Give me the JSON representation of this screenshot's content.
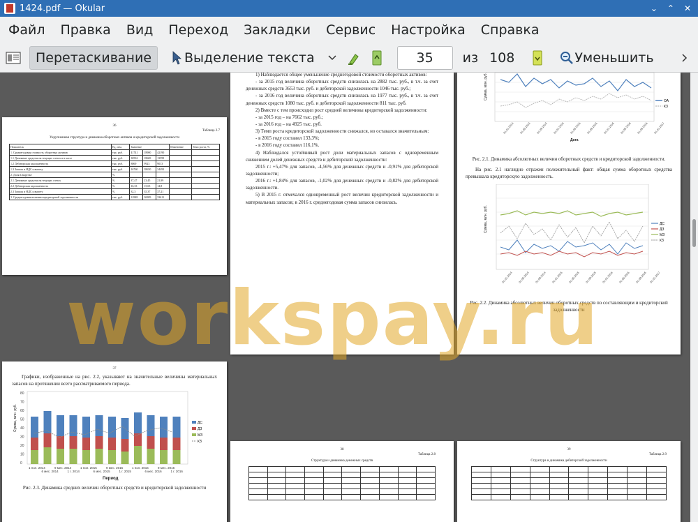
{
  "window": {
    "title": "1424.pdf  — Okular",
    "controls": [
      "⌄",
      "⌃",
      "✕"
    ]
  },
  "menu": [
    "Файл",
    "Правка",
    "Вид",
    "Переход",
    "Закладки",
    "Сервис",
    "Настройка",
    "Справка"
  ],
  "toolbar": {
    "drag_label": "Перетаскивание",
    "select_label": "Выделение текста",
    "page_value": "35",
    "of_label": "из",
    "total_pages": "108",
    "zoom_out_label": "Уменьшить"
  },
  "watermark": "workspay.ru",
  "left_page": {
    "page_no": "36",
    "table_label": "Таблица 2.7",
    "table_title": "Укрупненная структура и динамика оборотных активов и кредиторской задолженности",
    "col_header_0": "Показатель",
    "col_header_1": "Ед. изм.",
    "col_header_2": "Значение",
    "col_header_3": "Изменение",
    "col_header_4": "Темп роста, %",
    "rows": [
      [
        "1. Среднегодовая стоимость оборотных активов",
        "тыс. руб.",
        "41741",
        "18900",
        "42190"
      ],
      [
        "1.1 Денежные средства на текущих счетах и в кассе",
        "тыс. руб.",
        "30532",
        "18669",
        "13599"
      ],
      [
        "1.2 Дебиторская задолженность",
        "тыс. руб.",
        "8069",
        "9923",
        "9013"
      ],
      [
        "1.3 Запасы и НДС к вычету",
        "тыс. руб.",
        "16760",
        "38650",
        "34492"
      ],
      [
        "2. Доля в выручке",
        "%",
        "",
        "",
        ""
      ],
      [
        "2.1 Денежные средства на текущих счетах",
        "%",
        "37,47",
        "23,45",
        "21,99"
      ],
      [
        "2.2 Дебиторская задолженность",
        "%",
        "16,33",
        "15,65",
        "14,8"
      ],
      [
        "2.3 Запасы и НДС к вычету",
        "%",
        "32,3",
        "35,37",
        "37,21"
      ],
      [
        "3. Среднегодовая величина кредиторской задолженности",
        "тыс. руб.",
        "31848",
        "36909",
        "33611"
      ]
    ]
  },
  "center_page": {
    "p0": "1) Наблюдается общее уменьшение среднегодовой стоимости оборотных активов:",
    "p1": "- за 2015 год величина оборотных средств снизилась на 2882 тыс. руб., в т.ч. за счет денежных средств 3653 тыс. руб. и дебиторской задолженности 1046 тыс. руб.;",
    "p2": "- за 2016 год величина оборотных средств снизилась на 1977 тыс. руб., в т.ч. за счет денежных средств 1080 тыс. руб. и дебиторской задолженности 811 тыс. руб.",
    "p3": "2) Вместе с тем происходил рост средней величины кредиторской задолженности:",
    "p4": "- за 2015 год – на 7662 тыс. руб.;",
    "p5": "- за 2016 год – на 4925 тыс. руб.",
    "p6": "3) Темп роста кредиторской задолженности снижался, но оставался значительным:",
    "p7": "- в 2015 году составил 133,3%;",
    "p8": "- в 2016 году составил 116,1%.",
    "p9": "4) Наблюдался устойчивый рост доли материальных запасов с одновременным снижением долей денежных средств и дебиторской задолженности:",
    "p10": "2015 г.: +5,47% для запасов, -4,56% для денежных средств и -0,91% для дебиторской задолженности;",
    "p11": "2016 г.: +1,84% для запасов, -1,02% для денежных средств и -0,82% для дебиторской задолженности.",
    "p12": "5) В 2015 г. отмечался одновременный рост величин кредиторской задолженности и материальных запасов; в 2016 г. среднегодовая сумма запасов снизилась."
  },
  "right_page": {
    "fig1_caption": "Рис. 2.1. Динамика абсолютных величин оборотных средств и кредиторской задолженности.",
    "para": "На рис. 2.1 наглядно отражен положительный факт: общая сумма оборотных средства превышала кредиторскую задолженность.",
    "fig2_caption": "Рис. 2.2. Динамика абсолютных величин оборотных средств по составляющим и кредиторской задолженности",
    "ylabel": "Сумма, млн. руб.",
    "xlabel": "Дата",
    "legend1": [
      "ОА",
      "КЗ"
    ],
    "legend2": [
      "ДС",
      "ДЗ",
      "МЗ",
      "КЗ"
    ],
    "dates": [
      "01.01.2014",
      "01.03.2014",
      "01.05.2014",
      "01.07.2014",
      "01.09.2014",
      "01.11.2014",
      "01.01.2015",
      "01.03.2015",
      "01.05.2015",
      "01.07.2015",
      "01.09.2015",
      "01.11.2015",
      "01.01.2016",
      "01.03.2016",
      "01.05.2016",
      "01.07.2016",
      "01.09.2016",
      "01.11.2016",
      "01.01.2017"
    ]
  },
  "bottom_left_page": {
    "page_no": "37",
    "para": "Графики, изображенные на рис. 2.2, указывают на значительные величины материальных запасов на протяжении всего рассматриваемого периода.",
    "caption": "Рис. 2.3. Динамика средних величин оборотных средств и кредиторской задолженности",
    "xlabel": "Период",
    "ylabel": "Сумма, млн. руб.",
    "yticks": [
      "80",
      "70",
      "60",
      "50",
      "40",
      "30",
      "20",
      "10",
      "0"
    ],
    "categories": [
      "1 пол. 2014",
      "6 мес. 2014",
      "9 мес. 2014",
      "1 г. 2014",
      "1 пол. 2015",
      "6 мес. 2015",
      "9 мес. 2015",
      "1 г. 2015",
      "1 пол. 2016",
      "6 мес. 2016",
      "9 мес. 2016",
      "1 г. 2016"
    ],
    "legend": [
      "ДС",
      "ДЗ",
      "МЗ",
      "КЗ"
    ]
  },
  "bottom_center_page": {
    "page_no": "38",
    "table_label": "Таблица 2.8",
    "table_title": "Структура и динамика денежных средств"
  },
  "bottom_right_page": {
    "page_no": "39",
    "table_label": "Таблица 2.9",
    "table_title": "Структура и динамика дебиторской задолженности"
  },
  "colors": {
    "titlebar": "#2f6fb5",
    "watermark": "#e2a828",
    "series_ds": "#4f81bd",
    "series_dz": "#c0504d",
    "series_mz": "#9bbb59",
    "series_kz": "#7f7f7f"
  }
}
